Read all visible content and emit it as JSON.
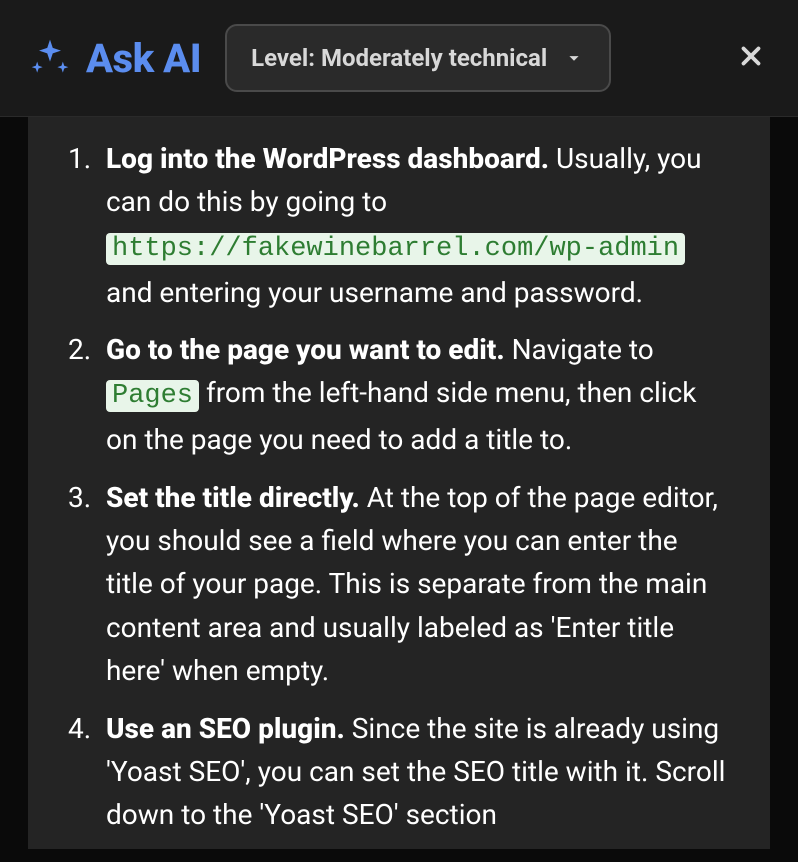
{
  "header": {
    "title": "Ask AI",
    "level_dropdown": {
      "label": "Level: Moderately technical"
    }
  },
  "steps": [
    {
      "bold": "Log into the WordPress dashboard.",
      "text_before_code": " Usually, you can do this by going to ",
      "code": "https://fakewinebarrel.com/wp-admin",
      "text_after_code": " and entering your username and password."
    },
    {
      "bold": "Go to the page you want to edit.",
      "text_before_code": " Navigate to ",
      "code": "Pages",
      "text_after_code": " from the left-hand side menu, then click on the page you need to add a title to."
    },
    {
      "bold": "Set the title directly.",
      "text_before_code": " At the top of the page editor, you should see a field where you can enter the title of your page. This is separate from the main content area and usually labeled as 'Enter title here' when empty.",
      "code": "",
      "text_after_code": ""
    },
    {
      "bold": "Use an SEO plugin.",
      "text_before_code": " Since the site is already using 'Yoast SEO', you can set the SEO title with it. Scroll down to the 'Yoast SEO' section",
      "code": "",
      "text_after_code": ""
    }
  ]
}
